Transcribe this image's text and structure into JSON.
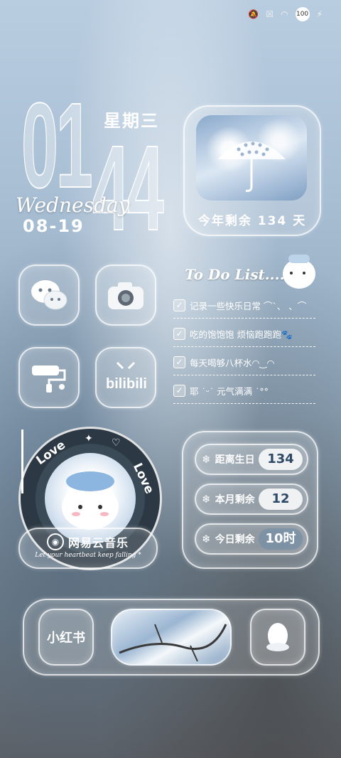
{
  "status_bar": {
    "battery": "100"
  },
  "clock": {
    "hour": "01",
    "minute": "44",
    "weekday": "星期三",
    "weekday_script": "Wednesday",
    "date": "08-19"
  },
  "year_widget": {
    "text": "今年剩余 134 天"
  },
  "apps": {
    "wechat": "WeChat",
    "camera": "Camera",
    "paint": "Paint",
    "bilibili": "bilibili"
  },
  "todo": {
    "title": "To Do List....",
    "items": [
      "记录一些快乐日常 ⌒`、 、⌒",
      "吃的饱饱饱 烦恼跑跑跑🐾",
      "每天喝够八杯水◠‿◠",
      "耶 ˙ᵕ˙ 元气满满 ˙°°"
    ]
  },
  "music": {
    "love_left": "Love",
    "love_right": "Love",
    "app_name": "网易云音乐",
    "tagline": "Let your heartbeat keep falling *"
  },
  "countdown": {
    "items": [
      {
        "label": "距离生日",
        "value": "134"
      },
      {
        "label": "本月剩余",
        "value": "12"
      },
      {
        "label": "今日剩余",
        "value": "10时"
      }
    ]
  },
  "dock": {
    "xiaohongshu": "小红书",
    "qq": "QQ"
  }
}
